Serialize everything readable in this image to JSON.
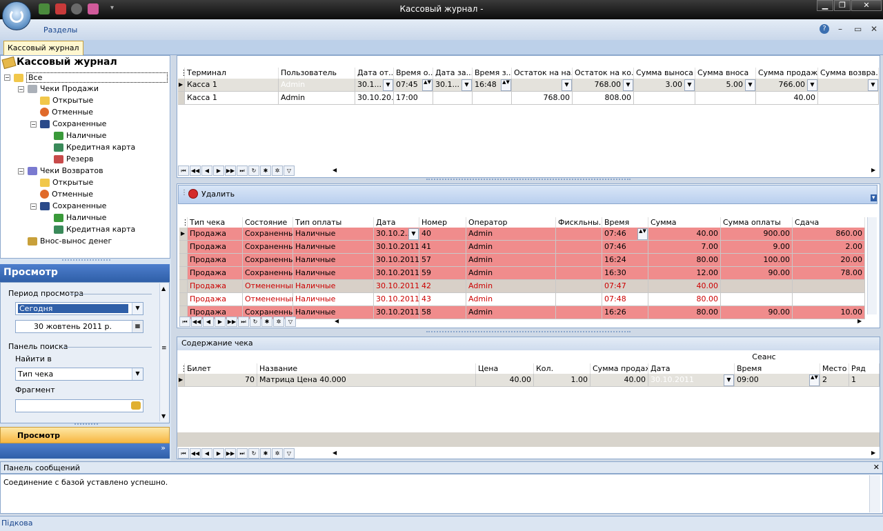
{
  "window": {
    "title": "Кассовый журнал -"
  },
  "ribbon": {
    "sections_label": "Разделы"
  },
  "doc_tab": "Кассовый журнал",
  "tree": {
    "title": "Кассовый журнал",
    "nodes": [
      {
        "label": "Все"
      },
      {
        "label": "Чеки Продажи"
      },
      {
        "label": "Открытые"
      },
      {
        "label": "Отменные"
      },
      {
        "label": "Сохраненные"
      },
      {
        "label": "Наличные"
      },
      {
        "label": "Кредитная карта"
      },
      {
        "label": "Резерв"
      },
      {
        "label": "Чеки Возвратов"
      },
      {
        "label": "Открытые"
      },
      {
        "label": "Отменные"
      },
      {
        "label": "Сохраненные"
      },
      {
        "label": "Наличные"
      },
      {
        "label": "Кредитная карта"
      },
      {
        "label": "Внос-вынос денег"
      }
    ]
  },
  "view": {
    "header": "Просмотр",
    "period_label": "Период просмотра",
    "period_value": "Сегодня",
    "date_value": "30 жовтень 2011 р.",
    "search_panel_label": "Панель поиска",
    "find_in_label": "Найити в",
    "find_in_value": "Тип чека",
    "fragment_label": "Фрагмент",
    "fragment_value": "",
    "button": "Просмотр"
  },
  "sessions": {
    "columns": [
      "Терминал",
      "Пользователь",
      "Дата от...",
      "Время о...",
      "Дата за...",
      "Время з...",
      "Остаток на на...",
      "Остаток на ко...",
      "Сумма выноса",
      "Сумма вноса",
      "Сумма продажи",
      "Сумма возвра..."
    ],
    "rows": [
      [
        "Касса 1",
        "Admin",
        "30.1...",
        "07:45",
        "30.1...",
        "16:48",
        "",
        "768.00",
        "3.00",
        "5.00",
        "766.00",
        ""
      ],
      [
        "Касса 1",
        "Admin",
        "30.10.20...",
        "17:00",
        "",
        "",
        "768.00",
        "808.00",
        "",
        "",
        "40.00",
        ""
      ]
    ]
  },
  "checks": {
    "delete_label": "Удалить",
    "columns": [
      "Тип чека",
      "Состояние",
      "Тип оплаты",
      "Дата",
      "Номер",
      "Оператор",
      "Фискльны...",
      "Время",
      "Сумма",
      "Сумма оплаты",
      "Сдача"
    ],
    "rows": [
      [
        "Продажа",
        "Сохраненный",
        "Наличные",
        "30.10.2...",
        "40",
        "Admin",
        "",
        "07:46",
        "40.00",
        "900.00",
        "860.00"
      ],
      [
        "Продажа",
        "Сохраненный",
        "Наличные",
        "30.10.2011",
        "41",
        "Admin",
        "",
        "07:46",
        "7.00",
        "9.00",
        "2.00"
      ],
      [
        "Продажа",
        "Сохраненный",
        "Наличные",
        "30.10.2011",
        "57",
        "Admin",
        "",
        "16:24",
        "80.00",
        "100.00",
        "20.00"
      ],
      [
        "Продажа",
        "Сохраненный",
        "Наличные",
        "30.10.2011",
        "59",
        "Admin",
        "",
        "16:30",
        "12.00",
        "90.00",
        "78.00"
      ],
      [
        "Продажа",
        "Отмененный",
        "Наличные",
        "30.10.2011",
        "42",
        "Admin",
        "",
        "07:47",
        "40.00",
        "",
        ""
      ],
      [
        "Продажа",
        "Отмененный",
        "Наличные",
        "30.10.2011",
        "43",
        "Admin",
        "",
        "07:48",
        "80.00",
        "",
        ""
      ],
      [
        "Продажа",
        "Сохраненный",
        "Наличные",
        "30.10.2011",
        "58",
        "Admin",
        "",
        "16:26",
        "80.00",
        "90.00",
        "10.00"
      ]
    ]
  },
  "content": {
    "title": "Содержание чека",
    "group_label": "Сеанс",
    "columns": [
      "Билет",
      "Название",
      "Цена",
      "Кол.",
      "Сумма продажи",
      "Дата",
      "Время",
      "Место",
      "Ряд"
    ],
    "row": [
      "70",
      "Матрица Цена 40.000",
      "40.00",
      "1.00",
      "40.00",
      "30.10.2011",
      "09:00",
      "2",
      "1"
    ]
  },
  "messages": {
    "title": "Панель сообщений",
    "text": "Соединение с базой уставлено успешно."
  },
  "status": {
    "text": "Підкова"
  },
  "colors": {
    "accent": "#2f5fa8",
    "saved_row": "#f08c8c",
    "cancelled_row": "#d8d0c8",
    "cancelled_text": "#cc0000"
  }
}
